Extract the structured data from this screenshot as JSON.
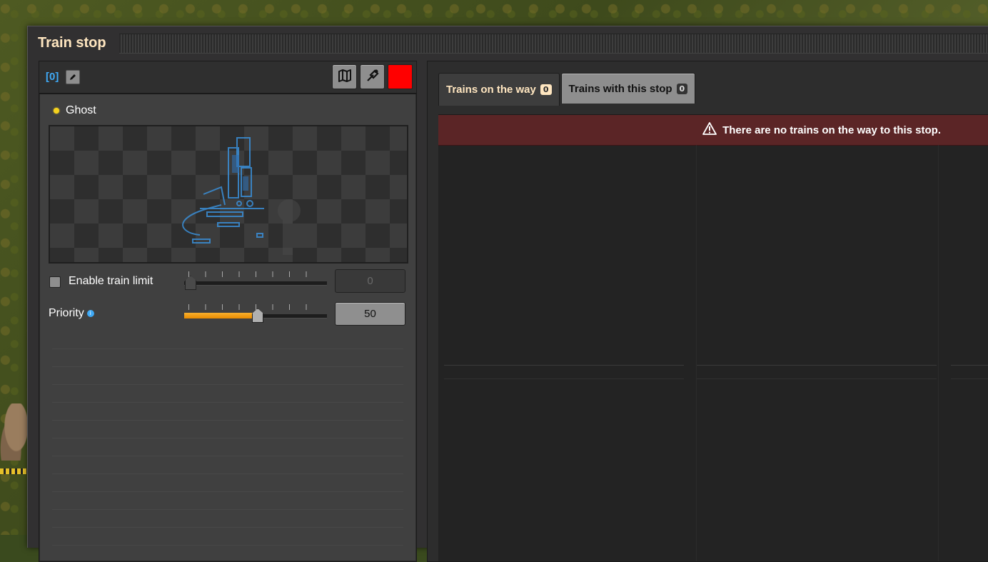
{
  "window": {
    "title": "Train stop"
  },
  "left": {
    "stop_name": "[0]",
    "status": {
      "label": "Ghost",
      "color": "#f5d21e"
    },
    "color_swatch": "#ff0000",
    "train_limit": {
      "label": "Enable train limit",
      "checked": false,
      "value": "0"
    },
    "priority": {
      "label": "Priority",
      "value": "50",
      "fraction": 0.5
    }
  },
  "right": {
    "tabs": [
      {
        "label": "Trains on the way",
        "count": "0",
        "active": true
      },
      {
        "label": "Trains with this stop",
        "count": "0",
        "active": false
      }
    ],
    "warning": "There are no trains on the way to this stop."
  },
  "colors": {
    "accent": "#ffe6c0",
    "warning_bg": "#5b2526",
    "slider_fill": "#f0a020",
    "name_color": "#3fa9f5"
  }
}
